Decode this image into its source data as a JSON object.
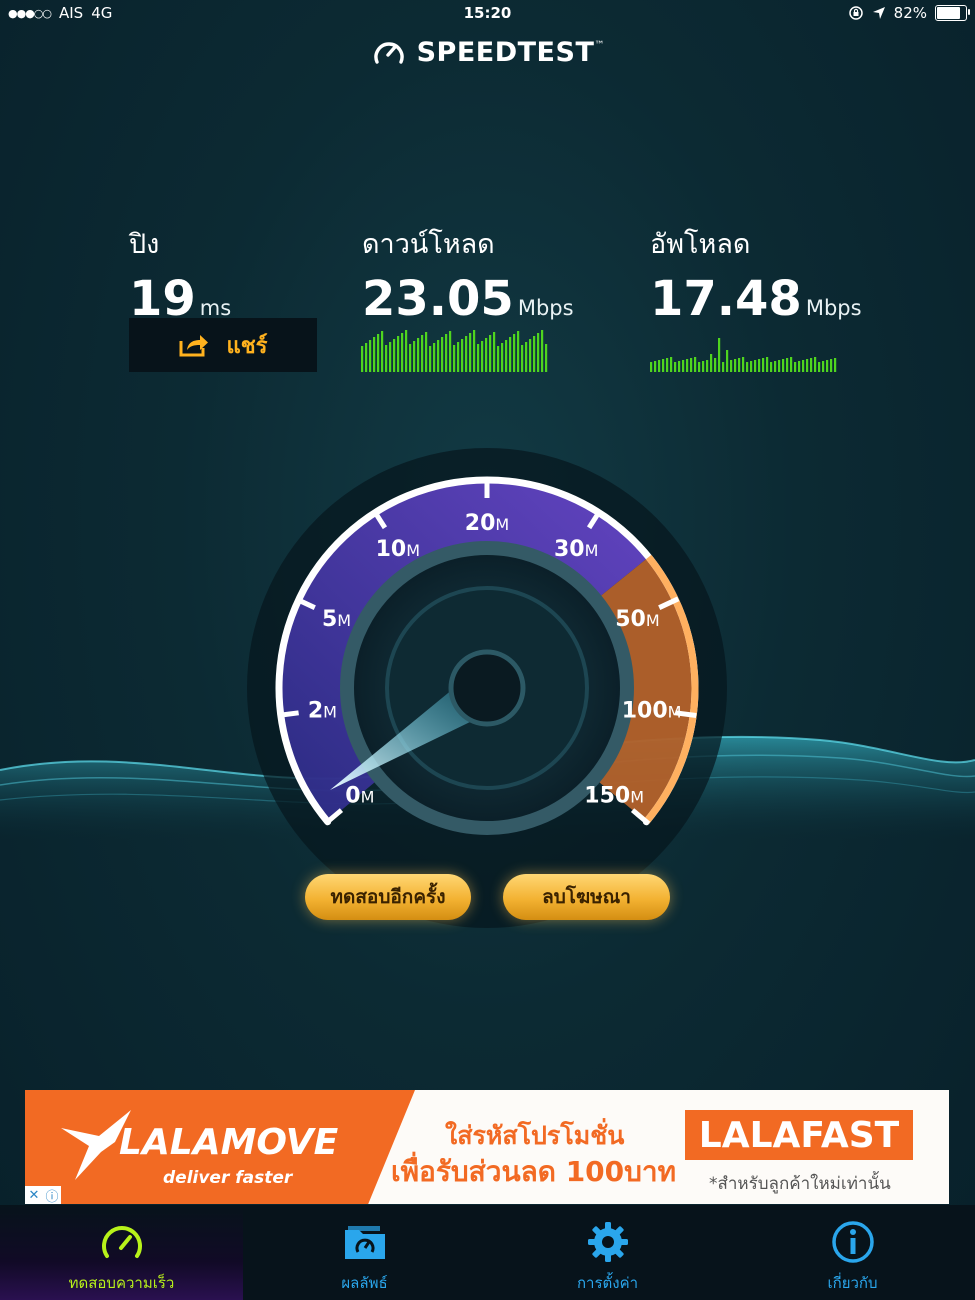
{
  "status_bar": {
    "carrier": "AIS",
    "network": "4G",
    "time": "15:20",
    "battery": "82%",
    "battery_level": 0.82
  },
  "app": {
    "title": "SPEEDTEST",
    "trademark": "™"
  },
  "metrics": {
    "ping": {
      "label": "ปิง",
      "value": "19",
      "unit": "ms"
    },
    "download": {
      "label": "ดาวน์โหลด",
      "value": "23.05",
      "unit": "Mbps"
    },
    "upload": {
      "label": "อัพโหลด",
      "value": "17.48",
      "unit": "Mbps"
    }
  },
  "share_button": {
    "label": "แชร์"
  },
  "gauge": {
    "ticks": [
      {
        "num": "0",
        "unit": "M"
      },
      {
        "num": "2",
        "unit": "M"
      },
      {
        "num": "5",
        "unit": "M"
      },
      {
        "num": "10",
        "unit": "M"
      },
      {
        "num": "20",
        "unit": "M"
      },
      {
        "num": "30",
        "unit": "M"
      },
      {
        "num": "50",
        "unit": "M"
      },
      {
        "num": "100",
        "unit": "M"
      },
      {
        "num": "150",
        "unit": "M"
      }
    ],
    "needle_speed_mbps": 0,
    "accent_colors": {
      "arc": "#7d5bf0",
      "high_zone": "#f08a3c"
    }
  },
  "buttons": {
    "retest": "ทดสอบอีกครั้ง",
    "remove_ads": "ลบโฆษณา"
  },
  "ad": {
    "brand": "LALAMOVE",
    "tagline": "deliver faster",
    "line1": "ใส่รหัสโปรโมชั่น",
    "line2": "เพื่อรับส่วนลด 100บาท",
    "promo_code": "LALAFAST",
    "note": "*สำหรับลูกค้าใหม่เท่านั้น"
  },
  "tabs": [
    {
      "label": "ทดสอบความเร็ว",
      "icon": "speedometer-icon",
      "active": true
    },
    {
      "label": "ผลลัพธ์",
      "icon": "folder-icon",
      "active": false
    },
    {
      "label": "การตั้งค่า",
      "icon": "gear-icon",
      "active": false
    },
    {
      "label": "เกี่ยวกับ",
      "icon": "info-icon",
      "active": false
    }
  ],
  "colors": {
    "accent_yellow": "#ffb21e",
    "tab_blue": "#2aa6ec",
    "active_green": "#b8f21a",
    "ad_orange": "#f26a23"
  }
}
